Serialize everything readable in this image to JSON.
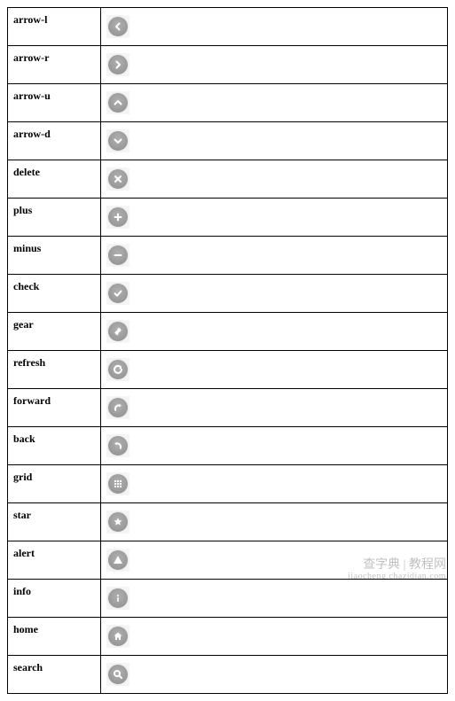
{
  "icons": [
    {
      "name": "arrow-l",
      "iconName": "arrow-left-icon",
      "svg": "arrow-l"
    },
    {
      "name": "arrow-r",
      "iconName": "arrow-right-icon",
      "svg": "arrow-r"
    },
    {
      "name": "arrow-u",
      "iconName": "arrow-up-icon",
      "svg": "arrow-u"
    },
    {
      "name": "arrow-d",
      "iconName": "arrow-down-icon",
      "svg": "arrow-d"
    },
    {
      "name": "delete",
      "iconName": "delete-icon",
      "svg": "delete"
    },
    {
      "name": "plus",
      "iconName": "plus-icon",
      "svg": "plus"
    },
    {
      "name": "minus",
      "iconName": "minus-icon",
      "svg": "minus"
    },
    {
      "name": "check",
      "iconName": "check-icon",
      "svg": "check"
    },
    {
      "name": "gear",
      "iconName": "gear-icon",
      "svg": "gear"
    },
    {
      "name": "refresh",
      "iconName": "refresh-icon",
      "svg": "refresh"
    },
    {
      "name": "forward",
      "iconName": "forward-icon",
      "svg": "forward"
    },
    {
      "name": "back",
      "iconName": "back-icon",
      "svg": "back"
    },
    {
      "name": "grid",
      "iconName": "grid-icon",
      "svg": "grid"
    },
    {
      "name": "star",
      "iconName": "star-icon",
      "svg": "star"
    },
    {
      "name": "alert",
      "iconName": "alert-icon",
      "svg": "alert"
    },
    {
      "name": "info",
      "iconName": "info-icon",
      "svg": "info"
    },
    {
      "name": "home",
      "iconName": "home-icon",
      "svg": "home"
    },
    {
      "name": "search",
      "iconName": "search-icon",
      "svg": "search"
    }
  ],
  "watermark": {
    "line1": "查字典 | 教程网",
    "line2": "jiaocheng.chazidian.com"
  }
}
